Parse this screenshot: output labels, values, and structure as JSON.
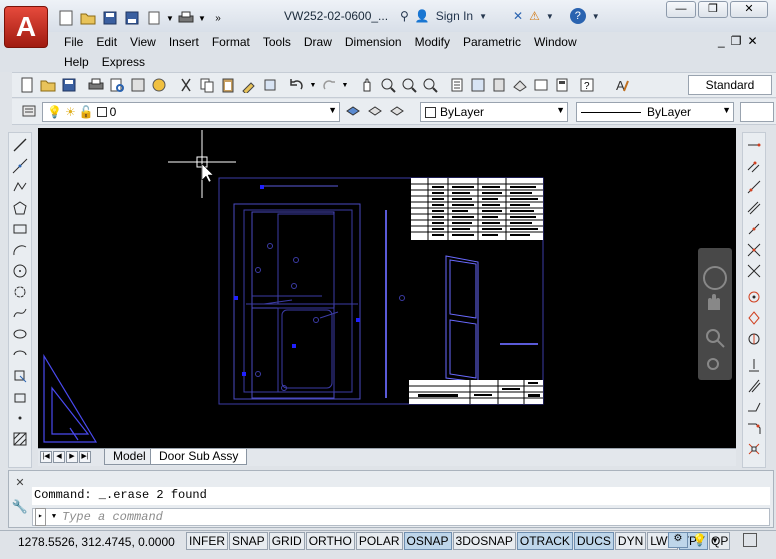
{
  "window": {
    "app_logo_letter": "A",
    "title": "VW252-02-0600_...",
    "sign_in": "Sign In",
    "controls": {
      "minimize": "—",
      "restore": "❐",
      "close": "✕"
    }
  },
  "menu": {
    "row1": [
      "File",
      "Edit",
      "View",
      "Insert",
      "Format",
      "Tools",
      "Draw",
      "Dimension",
      "Modify",
      "Parametric",
      "Window"
    ],
    "row2": [
      "Help",
      "Express"
    ],
    "doc_controls": {
      "minimize": "_",
      "restore": "❐",
      "close": "✕"
    }
  },
  "toolbar": {
    "text_style": "Standard",
    "layer_name": "0",
    "color": "ByLayer",
    "linetype": "ByLayer"
  },
  "layout_tabs": [
    {
      "label": "Model",
      "active": false
    },
    {
      "label": "Door Sub Assy",
      "active": true
    }
  ],
  "command": {
    "history": "Command:  _.erase 2 found",
    "placeholder": "Type a command",
    "prompt_symbol": "▸"
  },
  "status": {
    "coordinates": "1278.5526, 312.4745, 0.0000",
    "toggles": [
      {
        "label": "INFER",
        "on": false
      },
      {
        "label": "SNAP",
        "on": false
      },
      {
        "label": "GRID",
        "on": false
      },
      {
        "label": "ORTHO",
        "on": false
      },
      {
        "label": "POLAR",
        "on": false
      },
      {
        "label": "OSNAP",
        "on": true
      },
      {
        "label": "3DOSNAP",
        "on": false
      },
      {
        "label": "OTRACK",
        "on": true
      },
      {
        "label": "DUCS",
        "on": true
      },
      {
        "label": "DYN",
        "on": false
      },
      {
        "label": "LWT",
        "on": false
      },
      {
        "label": "TPY",
        "on": true
      },
      {
        "label": "QP",
        "on": false
      }
    ]
  },
  "colors": {
    "canvas": "#000000",
    "drawing_lines": "#3c3ca6",
    "title_block": "#ffffff",
    "status_on": "#bed6ea",
    "app_red": "#c0281b"
  }
}
